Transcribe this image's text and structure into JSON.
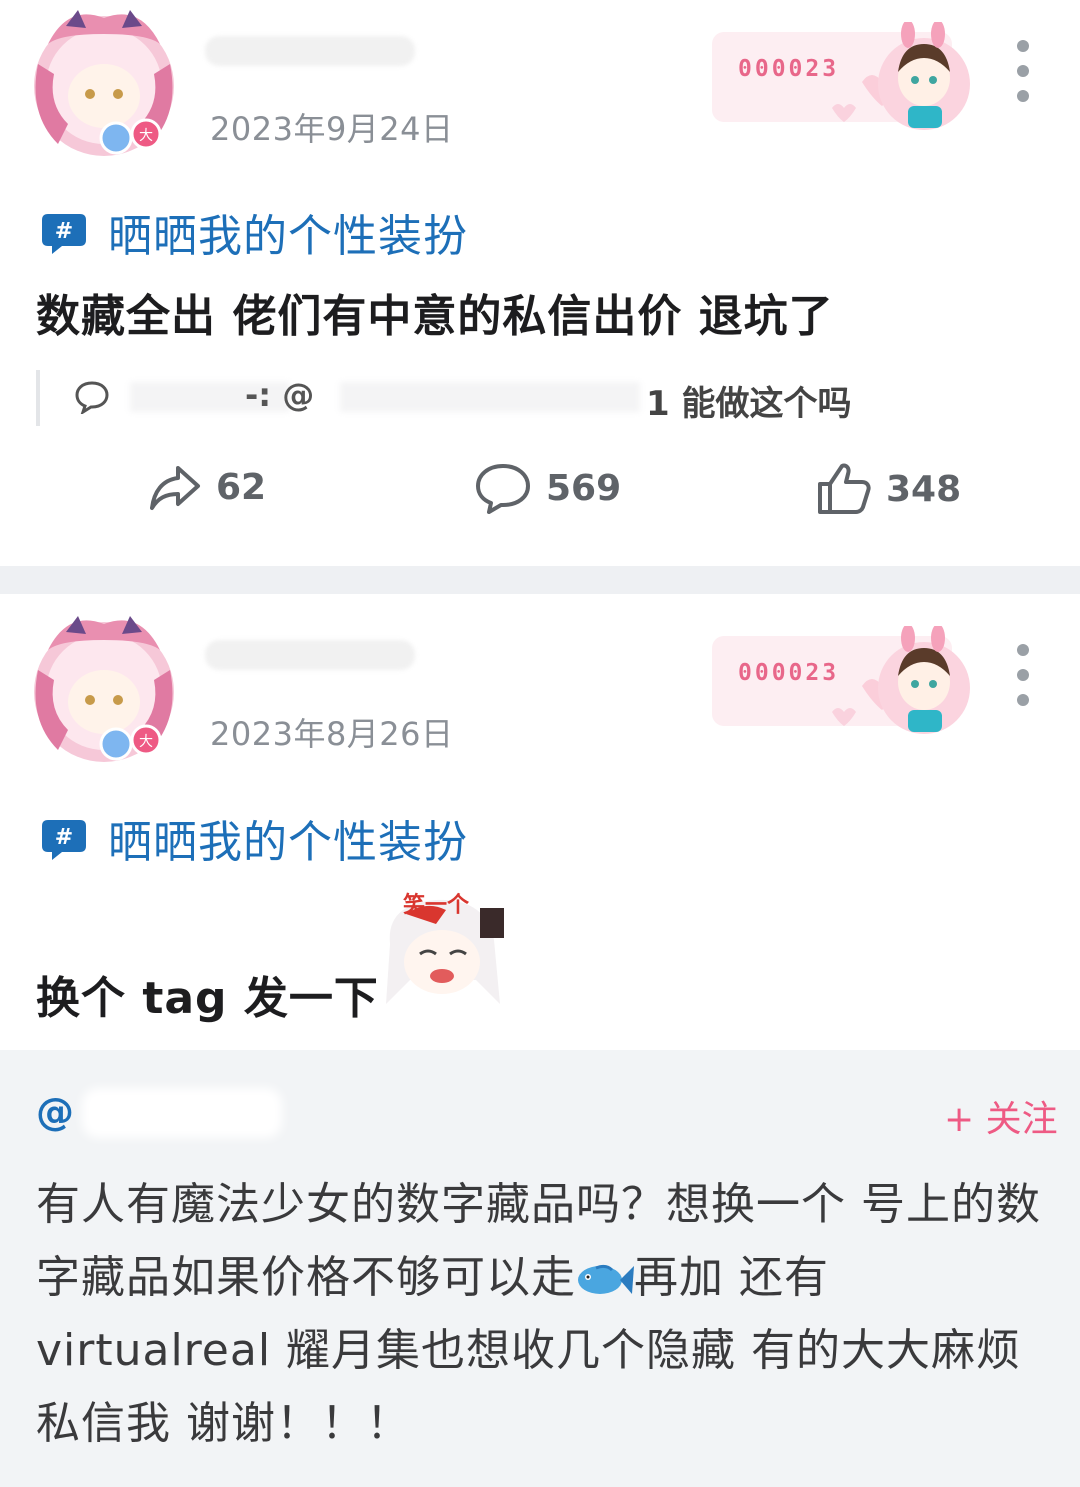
{
  "post1": {
    "date": "2023年9月24日",
    "badge_number": "000023",
    "topic": "晒晒我的个性装扮",
    "content": "数藏全出 佬们有中意的私信出价 退坑了",
    "comment_preview": {
      "prefix": "-: @",
      "text": "1 能做这个吗"
    },
    "actions": {
      "share_count": "62",
      "comment_count": "569",
      "like_count": "348"
    }
  },
  "post2": {
    "date": "2023年8月26日",
    "badge_number": "000023",
    "topic": "晒晒我的个性装扮",
    "content": "换个 tag 发一下",
    "sticker_text": "笑一个",
    "repost": {
      "at_symbol": "@",
      "follow_label": "+ 关注",
      "text_part1": "有人有魔法少女的数字藏品吗？想换一个 号上的数字藏品如果价格不够可以走",
      "text_part2": "再加 还有 virtualreal 耀月集也想收几个隐藏 有的大大麻烦私信我 谢谢！！！"
    }
  },
  "colors": {
    "link_blue": "#1d6fb8",
    "pink_accent": "#ee5a84",
    "gray_text": "#8a8f96"
  },
  "icons": [
    "more-icon",
    "topic-hash-icon",
    "comment-bubble-icon",
    "share-icon",
    "comment-icon",
    "like-icon",
    "fish-emoji-icon"
  ]
}
